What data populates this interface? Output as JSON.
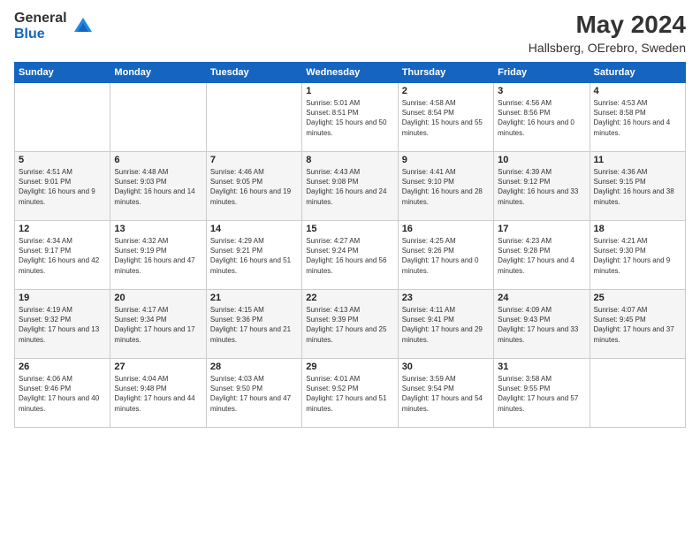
{
  "header": {
    "logo_general": "General",
    "logo_blue": "Blue",
    "title": "May 2024",
    "location": "Hallsberg, OErebro, Sweden"
  },
  "days_of_week": [
    "Sunday",
    "Monday",
    "Tuesday",
    "Wednesday",
    "Thursday",
    "Friday",
    "Saturday"
  ],
  "weeks": [
    [
      {
        "day": "",
        "sunrise": "",
        "sunset": "",
        "daylight": ""
      },
      {
        "day": "",
        "sunrise": "",
        "sunset": "",
        "daylight": ""
      },
      {
        "day": "",
        "sunrise": "",
        "sunset": "",
        "daylight": ""
      },
      {
        "day": "1",
        "sunrise": "Sunrise: 5:01 AM",
        "sunset": "Sunset: 8:51 PM",
        "daylight": "Daylight: 15 hours and 50 minutes."
      },
      {
        "day": "2",
        "sunrise": "Sunrise: 4:58 AM",
        "sunset": "Sunset: 8:54 PM",
        "daylight": "Daylight: 15 hours and 55 minutes."
      },
      {
        "day": "3",
        "sunrise": "Sunrise: 4:56 AM",
        "sunset": "Sunset: 8:56 PM",
        "daylight": "Daylight: 16 hours and 0 minutes."
      },
      {
        "day": "4",
        "sunrise": "Sunrise: 4:53 AM",
        "sunset": "Sunset: 8:58 PM",
        "daylight": "Daylight: 16 hours and 4 minutes."
      }
    ],
    [
      {
        "day": "5",
        "sunrise": "Sunrise: 4:51 AM",
        "sunset": "Sunset: 9:01 PM",
        "daylight": "Daylight: 16 hours and 9 minutes."
      },
      {
        "day": "6",
        "sunrise": "Sunrise: 4:48 AM",
        "sunset": "Sunset: 9:03 PM",
        "daylight": "Daylight: 16 hours and 14 minutes."
      },
      {
        "day": "7",
        "sunrise": "Sunrise: 4:46 AM",
        "sunset": "Sunset: 9:05 PM",
        "daylight": "Daylight: 16 hours and 19 minutes."
      },
      {
        "day": "8",
        "sunrise": "Sunrise: 4:43 AM",
        "sunset": "Sunset: 9:08 PM",
        "daylight": "Daylight: 16 hours and 24 minutes."
      },
      {
        "day": "9",
        "sunrise": "Sunrise: 4:41 AM",
        "sunset": "Sunset: 9:10 PM",
        "daylight": "Daylight: 16 hours and 28 minutes."
      },
      {
        "day": "10",
        "sunrise": "Sunrise: 4:39 AM",
        "sunset": "Sunset: 9:12 PM",
        "daylight": "Daylight: 16 hours and 33 minutes."
      },
      {
        "day": "11",
        "sunrise": "Sunrise: 4:36 AM",
        "sunset": "Sunset: 9:15 PM",
        "daylight": "Daylight: 16 hours and 38 minutes."
      }
    ],
    [
      {
        "day": "12",
        "sunrise": "Sunrise: 4:34 AM",
        "sunset": "Sunset: 9:17 PM",
        "daylight": "Daylight: 16 hours and 42 minutes."
      },
      {
        "day": "13",
        "sunrise": "Sunrise: 4:32 AM",
        "sunset": "Sunset: 9:19 PM",
        "daylight": "Daylight: 16 hours and 47 minutes."
      },
      {
        "day": "14",
        "sunrise": "Sunrise: 4:29 AM",
        "sunset": "Sunset: 9:21 PM",
        "daylight": "Daylight: 16 hours and 51 minutes."
      },
      {
        "day": "15",
        "sunrise": "Sunrise: 4:27 AM",
        "sunset": "Sunset: 9:24 PM",
        "daylight": "Daylight: 16 hours and 56 minutes."
      },
      {
        "day": "16",
        "sunrise": "Sunrise: 4:25 AM",
        "sunset": "Sunset: 9:26 PM",
        "daylight": "Daylight: 17 hours and 0 minutes."
      },
      {
        "day": "17",
        "sunrise": "Sunrise: 4:23 AM",
        "sunset": "Sunset: 9:28 PM",
        "daylight": "Daylight: 17 hours and 4 minutes."
      },
      {
        "day": "18",
        "sunrise": "Sunrise: 4:21 AM",
        "sunset": "Sunset: 9:30 PM",
        "daylight": "Daylight: 17 hours and 9 minutes."
      }
    ],
    [
      {
        "day": "19",
        "sunrise": "Sunrise: 4:19 AM",
        "sunset": "Sunset: 9:32 PM",
        "daylight": "Daylight: 17 hours and 13 minutes."
      },
      {
        "day": "20",
        "sunrise": "Sunrise: 4:17 AM",
        "sunset": "Sunset: 9:34 PM",
        "daylight": "Daylight: 17 hours and 17 minutes."
      },
      {
        "day": "21",
        "sunrise": "Sunrise: 4:15 AM",
        "sunset": "Sunset: 9:36 PM",
        "daylight": "Daylight: 17 hours and 21 minutes."
      },
      {
        "day": "22",
        "sunrise": "Sunrise: 4:13 AM",
        "sunset": "Sunset: 9:39 PM",
        "daylight": "Daylight: 17 hours and 25 minutes."
      },
      {
        "day": "23",
        "sunrise": "Sunrise: 4:11 AM",
        "sunset": "Sunset: 9:41 PM",
        "daylight": "Daylight: 17 hours and 29 minutes."
      },
      {
        "day": "24",
        "sunrise": "Sunrise: 4:09 AM",
        "sunset": "Sunset: 9:43 PM",
        "daylight": "Daylight: 17 hours and 33 minutes."
      },
      {
        "day": "25",
        "sunrise": "Sunrise: 4:07 AM",
        "sunset": "Sunset: 9:45 PM",
        "daylight": "Daylight: 17 hours and 37 minutes."
      }
    ],
    [
      {
        "day": "26",
        "sunrise": "Sunrise: 4:06 AM",
        "sunset": "Sunset: 9:46 PM",
        "daylight": "Daylight: 17 hours and 40 minutes."
      },
      {
        "day": "27",
        "sunrise": "Sunrise: 4:04 AM",
        "sunset": "Sunset: 9:48 PM",
        "daylight": "Daylight: 17 hours and 44 minutes."
      },
      {
        "day": "28",
        "sunrise": "Sunrise: 4:03 AM",
        "sunset": "Sunset: 9:50 PM",
        "daylight": "Daylight: 17 hours and 47 minutes."
      },
      {
        "day": "29",
        "sunrise": "Sunrise: 4:01 AM",
        "sunset": "Sunset: 9:52 PM",
        "daylight": "Daylight: 17 hours and 51 minutes."
      },
      {
        "day": "30",
        "sunrise": "Sunrise: 3:59 AM",
        "sunset": "Sunset: 9:54 PM",
        "daylight": "Daylight: 17 hours and 54 minutes."
      },
      {
        "day": "31",
        "sunrise": "Sunrise: 3:58 AM",
        "sunset": "Sunset: 9:55 PM",
        "daylight": "Daylight: 17 hours and 57 minutes."
      },
      {
        "day": "",
        "sunrise": "",
        "sunset": "",
        "daylight": ""
      }
    ]
  ]
}
